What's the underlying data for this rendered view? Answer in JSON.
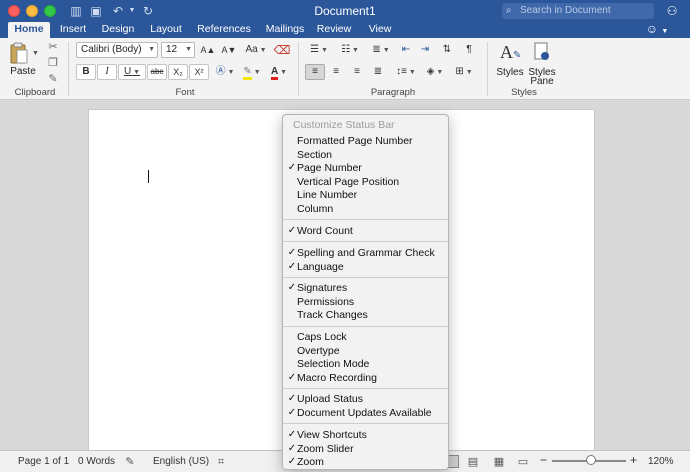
{
  "window": {
    "title": "Document1"
  },
  "search": {
    "placeholder": "Search in Document"
  },
  "tabs": [
    {
      "label": "Home",
      "active": true
    },
    {
      "label": "Insert"
    },
    {
      "label": "Design"
    },
    {
      "label": "Layout"
    },
    {
      "label": "References"
    },
    {
      "label": "Mailings"
    },
    {
      "label": "Review"
    },
    {
      "label": "View"
    }
  ],
  "ribbon": {
    "paste_label": "Paste",
    "font_name": "Calibri (Body)",
    "font_size": "12",
    "styles_label": "Styles",
    "styles_pane_label_1": "Styles",
    "styles_pane_label_2": "Pane",
    "groups": {
      "clipboard": "Clipboard",
      "font": "Font",
      "paragraph": "Paragraph",
      "styles": "Styles"
    },
    "font_buttons": {
      "bold": "B",
      "italic": "I",
      "underline": "U",
      "strike": "abc",
      "subscript": "X₂",
      "superscript": "X²",
      "grow": "A▲",
      "shrink": "A▼",
      "change_case": "Aa",
      "font_color": "A"
    }
  },
  "status": {
    "page": "Page 1 of 1",
    "words": "0 Words",
    "language": "English (US)",
    "zoom": "120%",
    "zoom_minus": "−",
    "zoom_plus": "+"
  },
  "menu": {
    "header": "Customize Status Bar",
    "check_glyph": "✓",
    "items": [
      {
        "label": "Formatted Page Number",
        "checked": false
      },
      {
        "label": "Section",
        "checked": false
      },
      {
        "label": "Page Number",
        "checked": true
      },
      {
        "label": "Vertical Page Position",
        "checked": false
      },
      {
        "label": "Line Number",
        "checked": false
      },
      {
        "label": "Column",
        "checked": false
      },
      {
        "label": "Word Count",
        "checked": true
      },
      {
        "label": "Spelling and Grammar Check",
        "checked": true
      },
      {
        "label": "Language",
        "checked": true
      },
      {
        "label": "Signatures",
        "checked": true
      },
      {
        "label": "Permissions",
        "checked": false
      },
      {
        "label": "Track Changes",
        "checked": false
      },
      {
        "label": "Caps Lock",
        "checked": false
      },
      {
        "label": "Overtype",
        "checked": false
      },
      {
        "label": "Selection Mode",
        "checked": false
      },
      {
        "label": "Macro Recording",
        "checked": true
      },
      {
        "label": "Upload Status",
        "checked": true
      },
      {
        "label": "Document Updates Available",
        "checked": true
      },
      {
        "label": "View Shortcuts",
        "checked": true
      },
      {
        "label": "Zoom Slider",
        "checked": true
      },
      {
        "label": "Zoom",
        "checked": true
      }
    ]
  }
}
